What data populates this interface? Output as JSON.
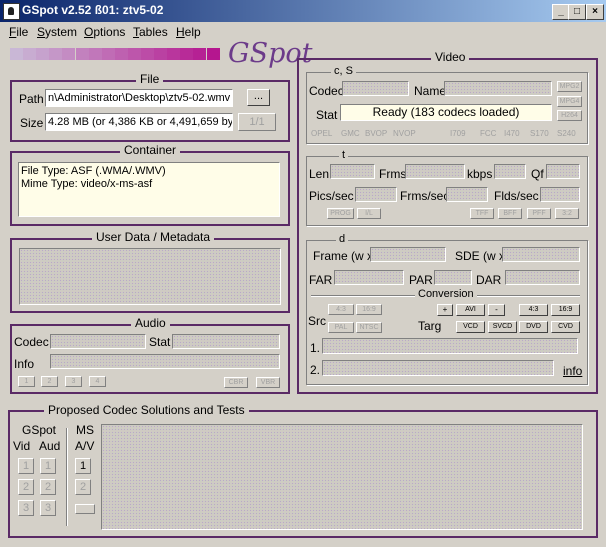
{
  "window": {
    "title": "GSpot v2.52 ß01: ztv5-02",
    "min": "_",
    "max": "□",
    "close": "×"
  },
  "menu": [
    {
      "label": "File",
      "u": "F",
      "rest": "ile"
    },
    {
      "label": "System",
      "u": "S",
      "rest": "ystem"
    },
    {
      "label": "Options",
      "u": "O",
      "rest": "ptions"
    },
    {
      "label": "Tables",
      "u": "T",
      "rest": "ables"
    },
    {
      "label": "Help",
      "u": "H",
      "rest": "elp"
    }
  ],
  "logo": "GSpot",
  "colors": {
    "frame": "#5a2a66",
    "gradient_start": "#c9b7d6",
    "gradient_end": "#b5168f"
  },
  "file": {
    "title": "File",
    "path_label": "Path",
    "path_value": "n\\Administrator\\Desktop\\ztv5-02.wmv",
    "browse": "...",
    "size_label": "Size",
    "size_value": "4.28 MB (or 4,386 KB or 4,491,659 byt",
    "counter": "1/1"
  },
  "container": {
    "title": "Container",
    "line1": "File Type: ASF (.WMA/.WMV)",
    "line2": "Mime Type: video/x-ms-asf"
  },
  "userdata": {
    "title": "User Data / Metadata"
  },
  "audio": {
    "title": "Audio",
    "codec_label": "Codec",
    "stat_label": "Stat",
    "info_label": "Info",
    "buttons": [
      "1",
      "2",
      "3",
      "4"
    ],
    "cbr": "CBR",
    "vbr": "VBR"
  },
  "video": {
    "title": "Video",
    "cs": {
      "title": "c, S",
      "codec_label": "Codec",
      "name_label": "Name",
      "stat_label": "Stat",
      "stat_value": "Ready (183 codecs loaded)",
      "tags_right": [
        "MPG2",
        "MPG4",
        "H264"
      ],
      "tags_bottom": [
        "OPEL",
        "GMC",
        "BVOP",
        "NVOP",
        "I709",
        "FCC",
        "I470",
        "S170",
        "S240"
      ]
    },
    "t": {
      "title": "t",
      "len": "Len",
      "frms": "Frms",
      "kbps": "kbps",
      "qf": "Qf",
      "pics": "Pics/sec",
      "frms_sec": "Frms/sec",
      "flds_sec": "Flds/sec",
      "tags": [
        "PROG",
        "I/L",
        "TFF",
        "BFF",
        "PFF",
        "3:2"
      ]
    },
    "d": {
      "title": "d",
      "frame": "Frame (w x",
      "sde": "SDE (w x",
      "far": "FAR",
      "par": "PAR",
      "dar": "DAR"
    },
    "conversion": {
      "title": "Conversion",
      "src": "Src",
      "targ": "Targ",
      "src_tags": [
        "4:3",
        "16:9",
        "PAL",
        "NTSC"
      ],
      "targ_top": [
        "+",
        "AVI",
        "-",
        "4:3",
        "16:9"
      ],
      "targ_bottom": [
        "VCD",
        "SVCD",
        "DVD",
        "CVD"
      ],
      "line1": "1.",
      "line2": "2.",
      "info": "info"
    }
  },
  "proposed": {
    "title": "Proposed Codec Solutions and Tests",
    "gspot": "GSpot",
    "vid": "Vid",
    "aud": "Aud",
    "ms": "MS",
    "av": "A/V",
    "vid_btns": [
      "1",
      "2",
      "3"
    ],
    "aud_btns": [
      "1",
      "2",
      "3"
    ],
    "ms_btns": [
      "1",
      "2"
    ]
  }
}
